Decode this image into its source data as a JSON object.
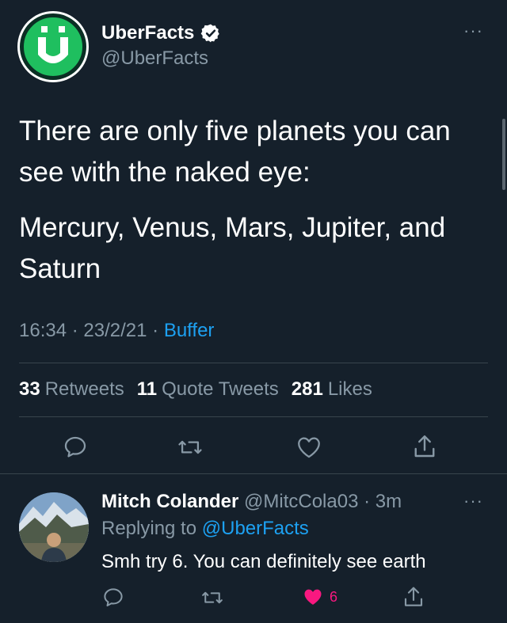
{
  "tweet": {
    "author_name": "UberFacts",
    "author_handle": "@UberFacts",
    "text_line1": "There are only five planets you can see with the naked eye:",
    "text_line2": "Mercury, Venus, Mars, Jupiter, and Saturn",
    "time": "16:34",
    "date": "23/2/21",
    "sep": "·",
    "source": "Buffer",
    "stats": {
      "retweets_count": "33",
      "retweets_label": "Retweets",
      "quotes_count": "11",
      "quotes_label": "Quote Tweets",
      "likes_count": "281",
      "likes_label": "Likes"
    },
    "more": "···",
    "avatar_letter": "Ü"
  },
  "reply": {
    "author_name": "Mitch Colander",
    "author_handle": "@MitcCola03",
    "sep": "·",
    "age": "3m",
    "replying_prefix": "Replying to",
    "replying_handle": "@UberFacts",
    "text": "Smh try 6. You can definitely see earth",
    "like_count": "6",
    "more": "···"
  },
  "colors": {
    "background": "#15202b",
    "accent": "#1da1f2",
    "like": "#f91880",
    "muted": "#8899a6",
    "brand_green": "#1fbf5f"
  },
  "icons": [
    "verified-badge-icon",
    "reply-icon",
    "retweet-icon",
    "like-icon",
    "share-icon",
    "more-icon"
  ]
}
